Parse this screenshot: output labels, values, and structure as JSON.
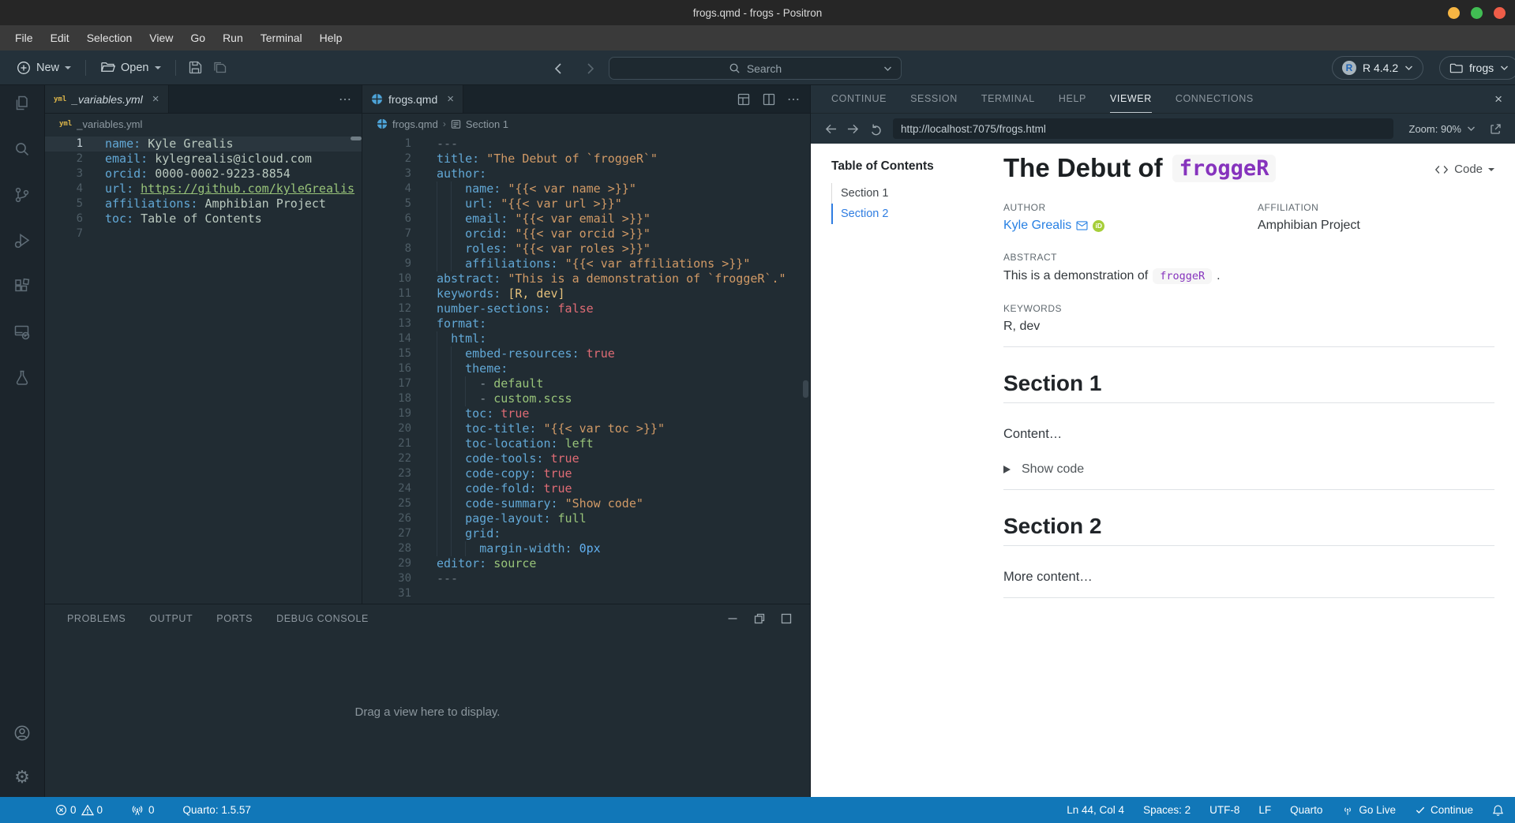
{
  "window": {
    "title": "frogs.qmd - frogs - Positron"
  },
  "menu": {
    "items": [
      "File",
      "Edit",
      "Selection",
      "View",
      "Go",
      "Run",
      "Terminal",
      "Help"
    ]
  },
  "toolbar": {
    "new_label": "New",
    "open_label": "Open",
    "search_placeholder": "Search",
    "r_version": "R 4.4.2",
    "project_name": "frogs"
  },
  "left_editor": {
    "tab": "_variables.yml",
    "breadcrumb_file": "_variables.yml",
    "active_line": 1,
    "lines": [
      [
        0,
        [
          [
            "k",
            "name: "
          ],
          [
            "v",
            "Kyle Grealis"
          ]
        ]
      ],
      [
        0,
        [
          [
            "k",
            "email: "
          ],
          [
            "v",
            "kylegrealis@icloud.com"
          ]
        ]
      ],
      [
        0,
        [
          [
            "k",
            "orcid: "
          ],
          [
            "v",
            "0000-0002-9223-8854"
          ]
        ]
      ],
      [
        0,
        [
          [
            "k",
            "url: "
          ],
          [
            "u",
            "https://github.com/kyleGrealis"
          ]
        ]
      ],
      [
        0,
        [
          [
            "k",
            "affiliations: "
          ],
          [
            "v",
            "Amphibian Project"
          ]
        ]
      ],
      [
        0,
        [
          [
            "k",
            "toc: "
          ],
          [
            "v",
            "Table of Contents"
          ]
        ]
      ],
      [
        0,
        []
      ]
    ]
  },
  "right_editor": {
    "tab": "frogs.qmd",
    "breadcrumb_file": "frogs.qmd",
    "breadcrumb_section": "Section 1",
    "active_line": 0,
    "lines": [
      [
        0,
        [
          [
            "c",
            "---"
          ]
        ]
      ],
      [
        0,
        [
          [
            "k",
            "title: "
          ],
          [
            "s",
            "\"The Debut of `froggeR`\""
          ]
        ]
      ],
      [
        0,
        [
          [
            "k",
            "author:"
          ]
        ]
      ],
      [
        2,
        [
          [
            "k",
            "name: "
          ],
          [
            "s",
            "\"{{< var name >}}\""
          ]
        ]
      ],
      [
        2,
        [
          [
            "k",
            "url: "
          ],
          [
            "s",
            "\"{{< var url >}}\""
          ]
        ]
      ],
      [
        2,
        [
          [
            "k",
            "email: "
          ],
          [
            "s",
            "\"{{< var email >}}\""
          ]
        ]
      ],
      [
        2,
        [
          [
            "k",
            "orcid: "
          ],
          [
            "s",
            "\"{{< var orcid >}}\""
          ]
        ]
      ],
      [
        2,
        [
          [
            "k",
            "roles: "
          ],
          [
            "s",
            "\"{{< var roles >}}\""
          ]
        ]
      ],
      [
        2,
        [
          [
            "k",
            "affiliations: "
          ],
          [
            "s",
            "\"{{< var affiliations >}}\""
          ]
        ]
      ],
      [
        0,
        [
          [
            "k",
            "abstract: "
          ],
          [
            "s",
            "\"This is a demonstration of `froggeR`.\""
          ]
        ]
      ],
      [
        0,
        [
          [
            "k",
            "keywords: "
          ],
          [
            "y",
            "[R, dev]"
          ]
        ]
      ],
      [
        0,
        [
          [
            "k",
            "number-sections: "
          ],
          [
            "b",
            "false"
          ]
        ]
      ],
      [
        0,
        [
          [
            "k",
            "format:"
          ]
        ]
      ],
      [
        1,
        [
          [
            "k",
            "html:"
          ]
        ]
      ],
      [
        2,
        [
          [
            "k",
            "embed-resources: "
          ],
          [
            "b",
            "true"
          ]
        ]
      ],
      [
        2,
        [
          [
            "k",
            "theme:"
          ]
        ]
      ],
      [
        3,
        [
          [
            "p",
            "- "
          ],
          [
            "g",
            "default"
          ]
        ]
      ],
      [
        3,
        [
          [
            "p",
            "- "
          ],
          [
            "g",
            "custom.scss"
          ]
        ]
      ],
      [
        2,
        [
          [
            "k",
            "toc: "
          ],
          [
            "b",
            "true"
          ]
        ]
      ],
      [
        2,
        [
          [
            "k",
            "toc-title: "
          ],
          [
            "s",
            "\"{{< var toc >}}\""
          ]
        ]
      ],
      [
        2,
        [
          [
            "k",
            "toc-location: "
          ],
          [
            "g",
            "left"
          ]
        ]
      ],
      [
        2,
        [
          [
            "k",
            "code-tools: "
          ],
          [
            "b",
            "true"
          ]
        ]
      ],
      [
        2,
        [
          [
            "k",
            "code-copy: "
          ],
          [
            "b",
            "true"
          ]
        ]
      ],
      [
        2,
        [
          [
            "k",
            "code-fold: "
          ],
          [
            "b",
            "true"
          ]
        ]
      ],
      [
        2,
        [
          [
            "k",
            "code-summary: "
          ],
          [
            "s",
            "\"Show code\""
          ]
        ]
      ],
      [
        2,
        [
          [
            "k",
            "page-layout: "
          ],
          [
            "g",
            "full"
          ]
        ]
      ],
      [
        2,
        [
          [
            "k",
            "grid:"
          ]
        ]
      ],
      [
        3,
        [
          [
            "k",
            "margin-width: "
          ],
          [
            "n",
            "0px"
          ]
        ]
      ],
      [
        0,
        [
          [
            "k",
            "editor: "
          ],
          [
            "g",
            "source"
          ]
        ]
      ],
      [
        0,
        [
          [
            "c",
            "---"
          ]
        ]
      ],
      [
        0,
        []
      ]
    ]
  },
  "bottom_panel": {
    "tabs": [
      "PROBLEMS",
      "OUTPUT",
      "PORTS",
      "DEBUG CONSOLE"
    ],
    "placeholder": "Drag a view here to display."
  },
  "right_panel": {
    "tabs": [
      "CONTINUE",
      "SESSION",
      "TERMINAL",
      "HELP",
      "VIEWER",
      "CONNECTIONS"
    ],
    "active_tab": "VIEWER",
    "nav": {
      "url": "http://localhost:7075/frogs.html",
      "zoom_label": "Zoom: 90%"
    }
  },
  "viewer": {
    "toc_title": "Table of Contents",
    "toc_items": [
      "Section 1",
      "Section 2"
    ],
    "toc_active_index": 1,
    "title": {
      "text": "The Debut of",
      "code": "froggeR"
    },
    "code_button_label": "Code",
    "meta": {
      "author_label": "AUTHOR",
      "author_name": "Kyle Grealis",
      "affiliation_label": "AFFILIATION",
      "affiliation": "Amphibian Project",
      "abstract_label": "ABSTRACT",
      "abstract_text": "This is a demonstration of",
      "abstract_code": "froggeR",
      "abstract_period": ".",
      "keywords_label": "KEYWORDS",
      "keywords": "R, dev"
    },
    "sections": [
      {
        "heading": "Section 1",
        "body": "Content…",
        "details": "Show code"
      },
      {
        "heading": "Section 2",
        "body": "More content…",
        "details": null
      }
    ]
  },
  "statusbar": {
    "errors": "0",
    "warnings": "0",
    "radio_count": "0",
    "quarto": "Quarto: 1.5.57",
    "line_col": "Ln 44, Col 4",
    "spaces": "Spaces: 2",
    "encoding": "UTF-8",
    "eol": "LF",
    "lang": "Quarto",
    "go_live": "Go Live",
    "continue_label": "Continue"
  },
  "colors": {
    "accent_blue": "#2780e3",
    "code_purple": "#8633bd",
    "orcid_green": "#a6ce39",
    "status_bar": "#1177b8",
    "traffic_yellow": "#f7b643",
    "traffic_green": "#41bd53",
    "traffic_red": "#ee5d48"
  }
}
